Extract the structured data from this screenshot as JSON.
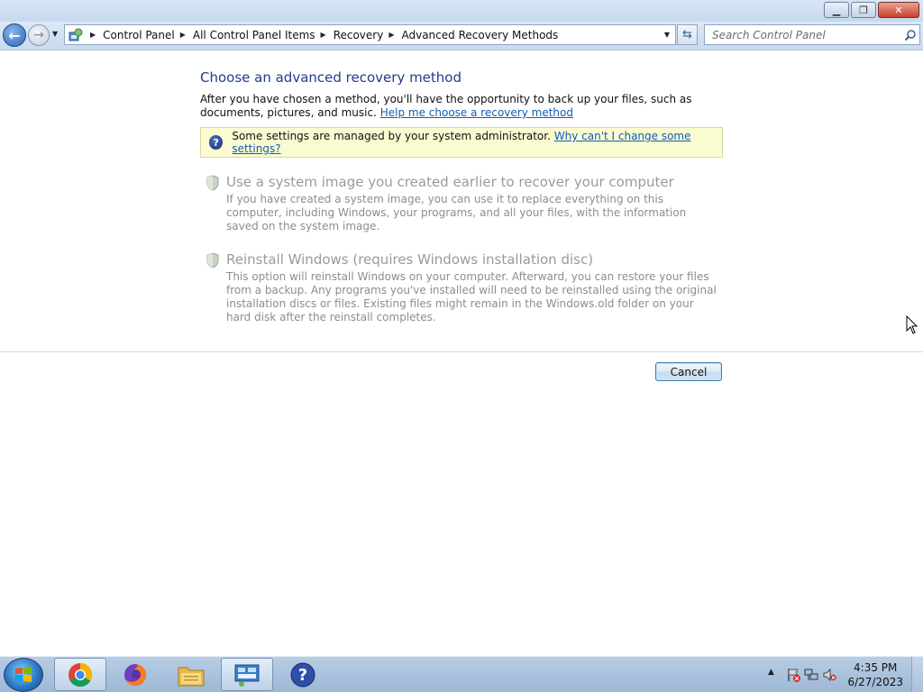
{
  "window": {
    "caption_buttons": {
      "minimize_icon": "minimize-icon",
      "maximize_icon": "restore-icon",
      "close_icon": "close-icon"
    }
  },
  "navbar": {
    "breadcrumbs": [
      "Control Panel",
      "All Control Panel Items",
      "Recovery",
      "Advanced Recovery Methods"
    ],
    "search_placeholder": "Search Control Panel"
  },
  "main": {
    "title": "Choose an advanced recovery method",
    "intro_text": "After you have chosen a method, you'll have the opportunity to back up your files, such as documents, pictures, and music.",
    "help_link": "Help me choose a recovery method",
    "info_text": "Some settings are managed by your system administrator.",
    "info_link": "Why can't I change some settings?",
    "options": [
      {
        "title": "Use a system image you created earlier to recover your computer",
        "description": "If you have created a system image, you can use it to replace everything on this computer, including Windows, your programs, and all your files, with the information saved on the system image."
      },
      {
        "title": "Reinstall Windows (requires Windows installation disc)",
        "description": "This option will reinstall Windows on your computer. Afterward, you can restore your files from a backup. Any programs you've installed will need to be reinstalled using the original installation discs or files. Existing files might remain in the Windows.old folder on your hard disk after the reinstall completes."
      }
    ],
    "cancel_label": "Cancel"
  },
  "taskbar": {
    "apps": [
      "chrome-icon",
      "firefox-icon",
      "file-explorer-icon",
      "control-panel-icon",
      "help-icon"
    ],
    "time": "4:35 PM",
    "date": "6/27/2023"
  },
  "colors": {
    "title_blue": "#1e3d8f",
    "link_blue": "#0f5db2",
    "disabled_gray": "#9a9a9a",
    "info_bg": "#fbfbd2"
  }
}
